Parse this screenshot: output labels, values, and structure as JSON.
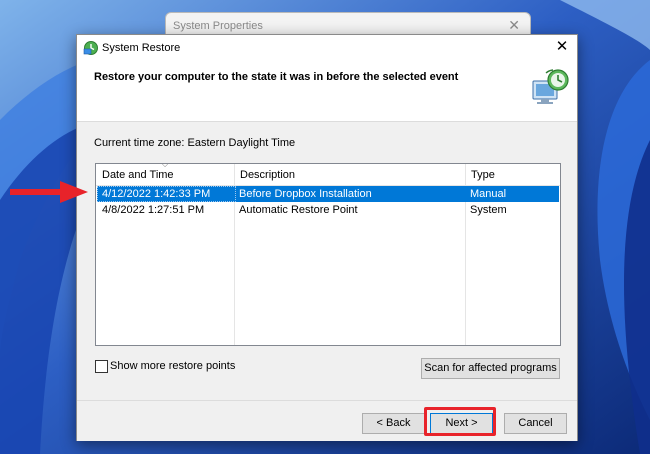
{
  "background_window": {
    "title": "System Properties",
    "close_glyph": "✕"
  },
  "dialog": {
    "title": "System Restore",
    "close_glyph": "✕",
    "heading": "Restore your computer to the state it was in before the selected event",
    "timezone_label": "Current time zone: Eastern Daylight Time",
    "columns": [
      "Date and Time",
      "Description",
      "Type"
    ],
    "rows": [
      {
        "date": "4/12/2022 1:42:33 PM",
        "description": "Before Dropbox Installation",
        "type": "Manual",
        "selected": true
      },
      {
        "date": "4/8/2022 1:27:51 PM",
        "description": "Automatic Restore Point",
        "type": "System",
        "selected": false
      }
    ],
    "show_more_label": "Show more restore points",
    "show_more_checked": false,
    "scan_button": "Scan for affected programs",
    "back_button": "< Back",
    "next_button": "Next >",
    "cancel_button": "Cancel"
  },
  "annotations": {
    "arrow_color": "#e8232a",
    "highlight_color": "#e8232a"
  },
  "colors": {
    "selection": "#0078d7",
    "wallpaper": "#1a3c8c"
  },
  "icons": [
    "system-restore-icon",
    "restore-graphic-icon",
    "close-icon",
    "sort-arrow-icon",
    "red-arrow-icon"
  ]
}
